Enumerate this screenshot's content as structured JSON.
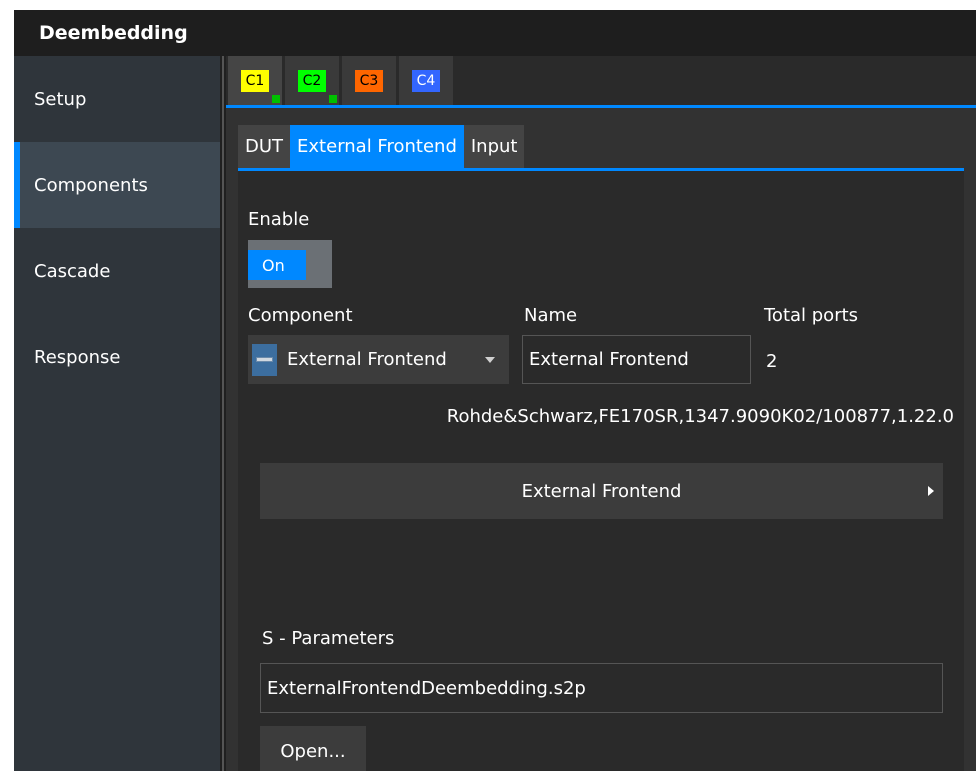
{
  "window": {
    "title": "Deembedding"
  },
  "sidebar": {
    "items": [
      {
        "label": "Setup"
      },
      {
        "label": "Components"
      },
      {
        "label": "Cascade"
      },
      {
        "label": "Response"
      }
    ]
  },
  "channels": {
    "tabs": [
      {
        "label": "C1",
        "color": "#ffff00",
        "dot_color": "#00c000"
      },
      {
        "label": "C2",
        "color": "#00ff00",
        "dot_color": "#00c000"
      },
      {
        "label": "C3",
        "color": "#ff6600"
      },
      {
        "label": "C4",
        "color": "#3366ff"
      }
    ]
  },
  "subtabs": [
    {
      "label": "DUT"
    },
    {
      "label": "External Frontend"
    },
    {
      "label": "Input"
    }
  ],
  "form": {
    "enable_label": "Enable",
    "enable_state": "On",
    "component_label": "Component",
    "component_value": "External Frontend",
    "name_label": "Name",
    "name_value": "External Frontend",
    "total_ports_label": "Total ports",
    "total_ports_value": "2",
    "device_id": "Rohde&Schwarz,FE170SR,1347.9090K02/100877,1.22.0",
    "expander_label": "External Frontend",
    "sparams_label": "S - Parameters",
    "sparams_file": "ExternalFrontendDeembedding.s2p",
    "open_button": "Open..."
  },
  "colors": {
    "accent": "#0088ff"
  }
}
